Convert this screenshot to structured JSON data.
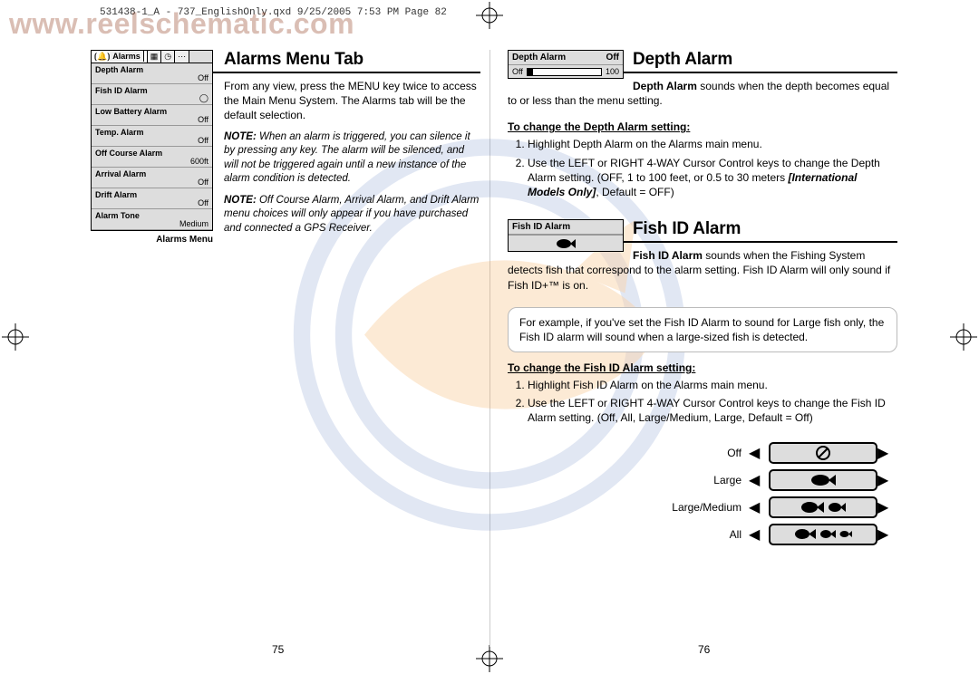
{
  "watermark_url": "www.reelschematic.com",
  "print_header": "531438-1_A - 737_EnglishOnly.qxd  9/25/2005  7:53 PM  Page 82",
  "alarms_menu": {
    "tab_label": "Alarms",
    "rows": [
      {
        "label": "Depth Alarm",
        "value": "Off"
      },
      {
        "label": "Fish ID Alarm",
        "value": "◯"
      },
      {
        "label": "Low Battery Alarm",
        "value": "Off"
      },
      {
        "label": "Temp. Alarm",
        "value": "Off"
      },
      {
        "label": "Off Course Alarm",
        "value": "600ft"
      },
      {
        "label": "Arrival Alarm",
        "value": "Off"
      },
      {
        "label": "Drift Alarm",
        "value": "Off"
      },
      {
        "label": "Alarm Tone",
        "value": "Medium"
      }
    ],
    "caption": "Alarms Menu"
  },
  "left": {
    "heading": "Alarms Menu Tab",
    "p1": "From any view, press the MENU key twice to access the Main Menu System. The Alarms tab will be the default selection.",
    "note1_label": "NOTE:",
    "note1": "When an alarm is triggered, you can silence it by pressing any key. The alarm will be silenced, and will not be triggered again until a new instance of the alarm condition is detected.",
    "note2_label": "NOTE:",
    "note2": "Off Course Alarm, Arrival Alarm, and Drift Alarm menu choices will only appear if you have purchased and connected a GPS Receiver."
  },
  "depth_box": {
    "title": "Depth Alarm",
    "val": "Off",
    "min": "Off",
    "max": "100"
  },
  "fish_id_box": {
    "title": "Fish ID Alarm"
  },
  "right": {
    "depth_heading": "Depth Alarm",
    "depth_p1a": "Depth Alarm",
    "depth_p1b": " sounds when the depth becomes equal to or less than the menu setting.",
    "depth_sub": "To change the Depth Alarm setting:",
    "depth_step1": "Highlight Depth Alarm on the Alarms main menu.",
    "depth_step2a": "Use the LEFT or RIGHT 4-WAY Cursor Control keys to change the Depth Alarm setting. (OFF, 1 to 100 feet, or 0.5 to 30 meters ",
    "depth_step2b": "[International Models Only]",
    "depth_step2c": ", Default = OFF)",
    "fish_heading": "Fish ID Alarm",
    "fish_p1a": "Fish ID Alarm",
    "fish_p1b": " sounds when the Fishing System detects fish that correspond to the alarm setting. Fish ID Alarm will only sound if Fish ID+™ is on.",
    "fish_callout": "For example, if you've set the Fish ID Alarm to sound for Large fish only, the Fish ID alarm will sound when a large-sized fish is detected.",
    "fish_sub": "To change the Fish ID Alarm setting:",
    "fish_step1": "Highlight Fish ID Alarm on the Alarms main menu.",
    "fish_step2": "Use the LEFT or RIGHT 4-WAY Cursor Control keys to change the Fish ID Alarm setting. (Off, All, Large/Medium, Large, Default = Off)",
    "options": {
      "off": "Off",
      "large": "Large",
      "largemed": "Large/Medium",
      "all": "All"
    }
  },
  "page_num_left": "75",
  "page_num_right": "76"
}
